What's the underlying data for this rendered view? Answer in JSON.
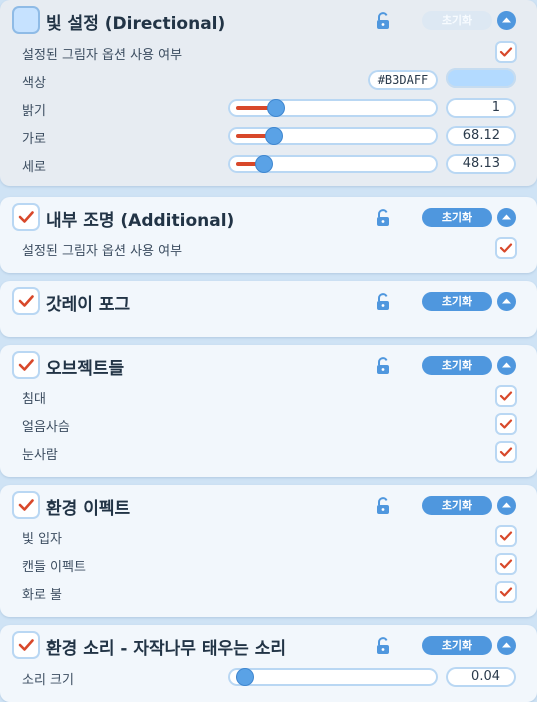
{
  "panels": [
    {
      "title": "빛 설정 (Directional)",
      "enabled": false,
      "reset_label": "초기화",
      "shadow_option": {
        "label": "설정된 그림자 옵션 사용 여부",
        "checked": true
      },
      "color": {
        "label": "색상",
        "hex": "#B3DAFF",
        "swatch": "#B3DAFF"
      },
      "sliders": [
        {
          "label": "밝기",
          "value": "1",
          "fraction": 0.2
        },
        {
          "label": "가로",
          "value": "68.12",
          "fraction": 0.19
        },
        {
          "label": "세로",
          "value": "48.13",
          "fraction": 0.13
        }
      ]
    },
    {
      "title": "내부 조명 (Additional)",
      "enabled": true,
      "reset_label": "초기화",
      "shadow_option": {
        "label": "설정된 그림자 옵션 사용 여부",
        "checked": true
      }
    },
    {
      "title": "갓레이 포그",
      "enabled": true,
      "reset_label": "초기화"
    },
    {
      "title": "오브젝트들",
      "enabled": true,
      "reset_label": "초기화",
      "items": [
        {
          "label": "침대",
          "checked": true
        },
        {
          "label": "얼음사슴",
          "checked": true
        },
        {
          "label": "눈사람",
          "checked": true
        }
      ]
    },
    {
      "title": "환경 이펙트",
      "enabled": true,
      "reset_label": "초기화",
      "items": [
        {
          "label": "빛 입자",
          "checked": true
        },
        {
          "label": "캔들 이펙트",
          "checked": true
        },
        {
          "label": "화로 불",
          "checked": true
        }
      ]
    },
    {
      "title": "환경 소리 - 자작나무 태우는 소리",
      "enabled": true,
      "reset_label": "초기화",
      "sliders": [
        {
          "label": "소리 크기",
          "value": "0.04",
          "fraction": 0.04
        }
      ]
    }
  ],
  "icons": {
    "lock": "unlock-icon",
    "collapse": "chevron-up-icon",
    "check": "checkmark-icon"
  },
  "colors": {
    "accent": "#4f97de",
    "check": "#d8482a",
    "panel_bg": "#f2f7fc",
    "page_bg": "#cfe3f5"
  }
}
